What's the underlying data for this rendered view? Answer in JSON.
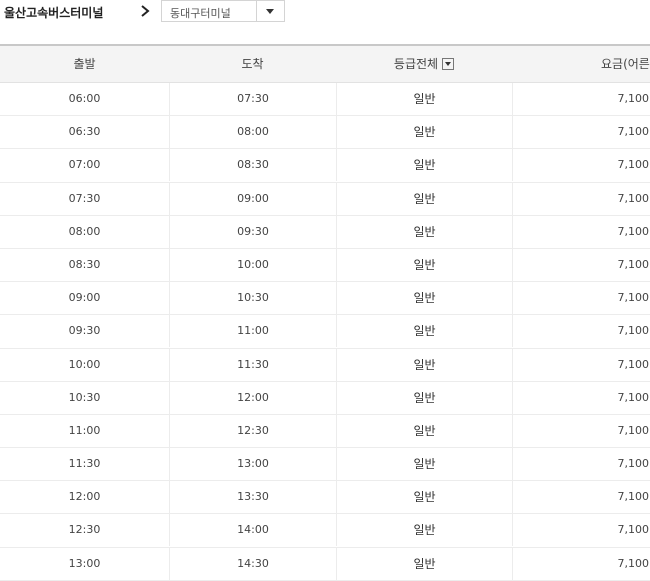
{
  "route": {
    "origin": "울산고속버스터미널",
    "destination": "동대구터미널"
  },
  "table": {
    "headers": {
      "departure": "출발",
      "arrival": "도착",
      "grade": "등급전체",
      "fare": "요금(어른"
    },
    "rows": [
      {
        "dep": "06:00",
        "arr": "07:30",
        "grade": "일반",
        "fare": "7,100"
      },
      {
        "dep": "06:30",
        "arr": "08:00",
        "grade": "일반",
        "fare": "7,100"
      },
      {
        "dep": "07:00",
        "arr": "08:30",
        "grade": "일반",
        "fare": "7,100"
      },
      {
        "dep": "07:30",
        "arr": "09:00",
        "grade": "일반",
        "fare": "7,100"
      },
      {
        "dep": "08:00",
        "arr": "09:30",
        "grade": "일반",
        "fare": "7,100"
      },
      {
        "dep": "08:30",
        "arr": "10:00",
        "grade": "일반",
        "fare": "7,100"
      },
      {
        "dep": "09:00",
        "arr": "10:30",
        "grade": "일반",
        "fare": "7,100"
      },
      {
        "dep": "09:30",
        "arr": "11:00",
        "grade": "일반",
        "fare": "7,100"
      },
      {
        "dep": "10:00",
        "arr": "11:30",
        "grade": "일반",
        "fare": "7,100"
      },
      {
        "dep": "10:30",
        "arr": "12:00",
        "grade": "일반",
        "fare": "7,100"
      },
      {
        "dep": "11:00",
        "arr": "12:30",
        "grade": "일반",
        "fare": "7,100"
      },
      {
        "dep": "11:30",
        "arr": "13:00",
        "grade": "일반",
        "fare": "7,100"
      },
      {
        "dep": "12:00",
        "arr": "13:30",
        "grade": "일반",
        "fare": "7,100"
      },
      {
        "dep": "12:30",
        "arr": "14:00",
        "grade": "일반",
        "fare": "7,100"
      },
      {
        "dep": "13:00",
        "arr": "14:30",
        "grade": "일반",
        "fare": "7,100"
      }
    ]
  },
  "icons": {
    "route_arrow": "chevron-right-icon",
    "dropdown": "caret-down-icon",
    "grade_filter": "caret-down-icon"
  }
}
